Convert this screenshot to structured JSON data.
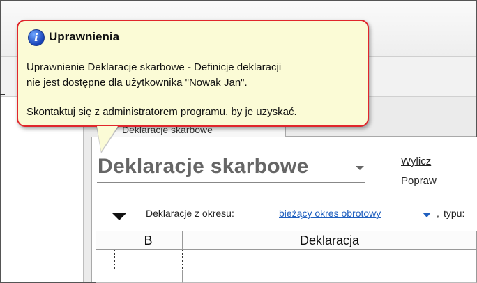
{
  "workspace": {
    "tab_label": "Deklaracje skarbowe"
  },
  "page": {
    "title": "Deklaracje skarbowe",
    "actions": [
      "Wylicz",
      "Popraw"
    ]
  },
  "filter": {
    "label": "Deklaracje z okresu:",
    "value": "bieżący okres obrotowy",
    "separator": ",",
    "next_label": "typu:"
  },
  "grid": {
    "columns": [
      "B",
      "Deklaracja"
    ]
  },
  "tooltip": {
    "title": "Uprawnienia",
    "lines": [
      "Uprawnienie Deklaracje skarbowe - Definicje deklaracji",
      "nie jest dostępne dla użytkownika \"Nowak Jan\".",
      "Skontaktuj się z administratorem programu, by je uzyskać."
    ],
    "icon": "info-icon",
    "border_color": "#e0262c",
    "background": "#fbfbd6"
  }
}
